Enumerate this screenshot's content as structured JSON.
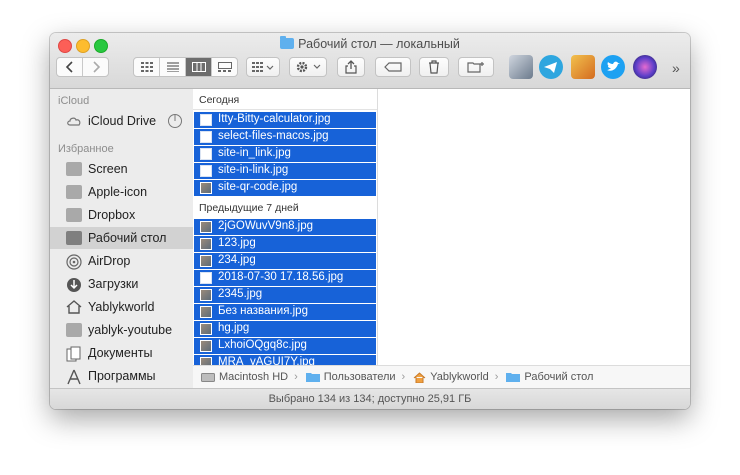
{
  "window": {
    "title": "Рабочий стол — локальный"
  },
  "toolbar": {
    "back_icon": "chevron-left-icon",
    "forward_icon": "chevron-right-icon",
    "views": [
      "icons",
      "list",
      "columns",
      "gallery"
    ],
    "active_view": "columns",
    "more": "»"
  },
  "sidebar": {
    "icloud_heading": "iCloud",
    "icloud_drive": "iCloud Drive",
    "favorites_heading": "Избранное",
    "items": [
      {
        "label": "Screen",
        "icon": "folder-icon"
      },
      {
        "label": "Apple-icon",
        "icon": "folder-icon"
      },
      {
        "label": "Dropbox",
        "icon": "folder-icon"
      },
      {
        "label": "Рабочий стол",
        "icon": "desktop-folder-icon",
        "selected": true
      },
      {
        "label": "AirDrop",
        "icon": "airdrop-icon"
      },
      {
        "label": "Загрузки",
        "icon": "downloads-icon"
      },
      {
        "label": "Yablykworld",
        "icon": "home-icon"
      },
      {
        "label": "yablyk-youtube",
        "icon": "folder-icon"
      },
      {
        "label": "Документы",
        "icon": "documents-icon"
      },
      {
        "label": "Программы",
        "icon": "applications-icon"
      }
    ]
  },
  "files": {
    "today_heading": "Сегодня",
    "today": [
      "Itty-Bitty-calculator.jpg",
      "select-files-macos.jpg",
      "site-in_link.jpg",
      "site-in-link.jpg",
      "site-qr-code.jpg"
    ],
    "week_heading": "Предыдущие 7 дней",
    "week": [
      "2jGOWuvV9n8.jpg",
      "123.jpg",
      "234.jpg",
      "2018-07-30 17.18.56.jpg",
      "2345.jpg",
      "Без названия.jpg",
      "hg.jpg",
      "LxhoiOQgq8c.jpg",
      "MRA_yAGUI7Y.jpg"
    ]
  },
  "pathbar": {
    "segments": [
      "Macintosh HD",
      "Пользователи",
      "Yablykworld",
      "Рабочий стол"
    ]
  },
  "status": {
    "text": "Выбрано 134 из 134; доступно 25,91 ГБ"
  },
  "colors": {
    "selection": "#1762d8",
    "sidebar": "#ececec"
  }
}
